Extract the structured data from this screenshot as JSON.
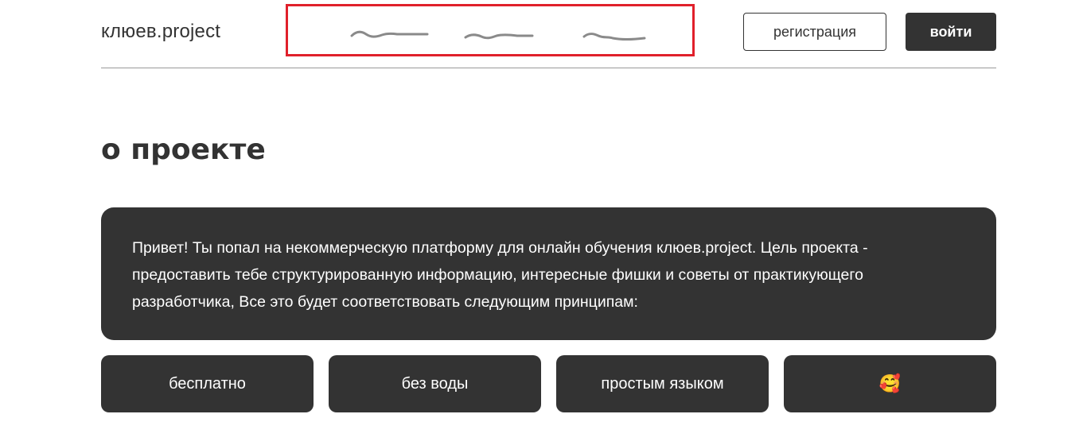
{
  "header": {
    "logo": "клюев.project",
    "register_label": "регистрация",
    "login_label": "войти"
  },
  "main": {
    "title": "о проекте",
    "intro": "Привет! Ты попал на некоммерческую платформу для онлайн обучения клюев.project. Цель проекта - предоставить тебе структурированную информацию, интересные фишки и советы от практикующего разработчика, Все это будет соответствовать следующим принципам:",
    "principles": [
      "бесплатно",
      "без воды",
      "простым языком",
      "🥰"
    ]
  },
  "colors": {
    "primary": "#333333",
    "highlight_box": "#e0202b",
    "background": "#ffffff",
    "scribble": "#8a8a8a"
  }
}
